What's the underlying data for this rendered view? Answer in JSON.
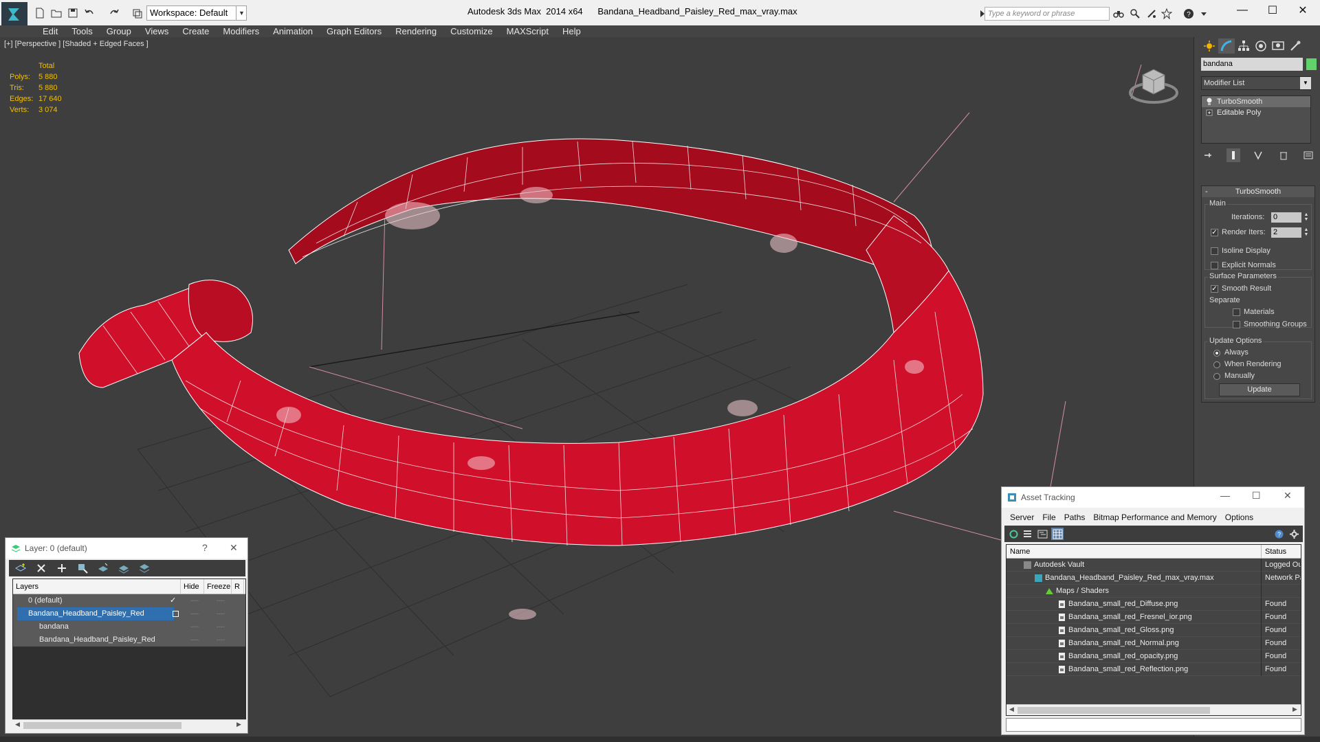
{
  "titlebar": {
    "workspace": "Workspace: Default",
    "app_version": "Autodesk 3ds Max  2014 x64",
    "filename": "Bandana_Headband_Paisley_Red_max_vray.max",
    "search_placeholder": "Type a keyword or phrase",
    "minimize_glyph": "—",
    "maximize_glyph": "☐",
    "close_glyph": "✕"
  },
  "menu": [
    "Edit",
    "Tools",
    "Group",
    "Views",
    "Create",
    "Modifiers",
    "Animation",
    "Graph Editors",
    "Rendering",
    "Customize",
    "MAXScript",
    "Help"
  ],
  "viewport": {
    "label": "[+] [Perspective ] [Shaded + Edged Faces ]",
    "stats_header": "Total",
    "stats": [
      {
        "k": "Polys:",
        "v": "5 880"
      },
      {
        "k": "Tris:",
        "v": "5 880"
      },
      {
        "k": "Edges:",
        "v": "17 640"
      },
      {
        "k": "Verts:",
        "v": "3 074"
      }
    ],
    "model_color": "#d0102a",
    "wire_color": "#ffffff"
  },
  "command_panel": {
    "object_name": "bandana",
    "object_color": "#62d36a",
    "modifier_list": "Modifier List",
    "stack": [
      "TurboSmooth",
      "Editable Poly"
    ],
    "rollout": "TurboSmooth",
    "main_group": "Main",
    "iterations_label": "Iterations:",
    "iterations": "0",
    "render_iters_label": "Render Iters:",
    "render_iters": "2",
    "isoline": "Isoline Display",
    "explicit_normals": "Explicit Normals",
    "surface_group": "Surface Parameters",
    "smooth_result": "Smooth Result",
    "separate": "Separate",
    "materials": "Materials",
    "smoothing_groups": "Smoothing Groups",
    "update_group": "Update Options",
    "always": "Always",
    "when_rendering": "When Rendering",
    "manually": "Manually",
    "update_btn": "Update"
  },
  "layer_dialog": {
    "title": "Layer: 0 (default)",
    "help_glyph": "?",
    "close_glyph": "✕",
    "cols": [
      "Layers",
      "Hide",
      "Freeze",
      "R"
    ],
    "rows": [
      {
        "name": "0 (default)",
        "indent": 1,
        "selected": false
      },
      {
        "name": "Bandana_Headband_Paisley_Red",
        "indent": 1,
        "selected": true
      },
      {
        "name": "bandana",
        "indent": 2,
        "selected": false
      },
      {
        "name": "Bandana_Headband_Paisley_Red",
        "indent": 2,
        "selected": false
      }
    ],
    "dash": "----"
  },
  "asset_dialog": {
    "title": "Asset Tracking",
    "menu": [
      "Server",
      "File",
      "Paths",
      "Bitmap Performance and Memory",
      "Options"
    ],
    "col_name": "Name",
    "col_status": "Status",
    "rows": [
      {
        "name": "Autodesk Vault",
        "status": "Logged Ou",
        "indent": 1
      },
      {
        "name": "Bandana_Headband_Paisley_Red_max_vray.max",
        "status": "Network Pa",
        "indent": 2
      },
      {
        "name": "Maps / Shaders",
        "status": "",
        "indent": 3
      },
      {
        "name": "Bandana_small_red_Diffuse.png",
        "status": "Found",
        "indent": 4
      },
      {
        "name": "Bandana_small_red_Fresnel_ior.png",
        "status": "Found",
        "indent": 4
      },
      {
        "name": "Bandana_small_red_Gloss.png",
        "status": "Found",
        "indent": 4
      },
      {
        "name": "Bandana_small_red_Normal.png",
        "status": "Found",
        "indent": 4
      },
      {
        "name": "Bandana_small_red_opacity.png",
        "status": "Found",
        "indent": 4
      },
      {
        "name": "Bandana_small_red_Reflection.png",
        "status": "Found",
        "indent": 4
      }
    ]
  }
}
